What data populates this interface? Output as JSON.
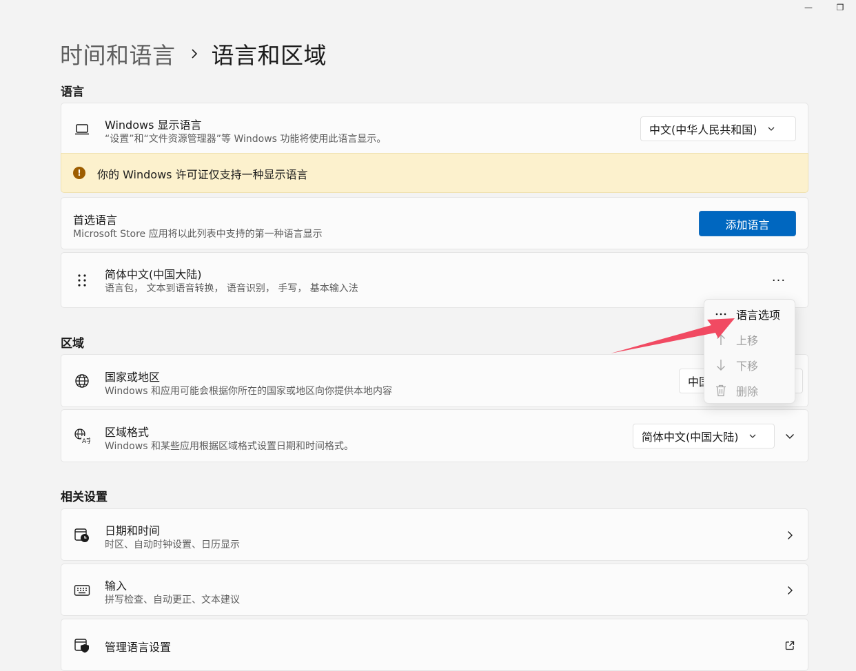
{
  "window": {
    "minimize_glyph": "—",
    "restore_glyph": "❐"
  },
  "breadcrumb": {
    "parent": "时间和语言",
    "separator": "›",
    "current": "语言和区域"
  },
  "sections": {
    "language": "语言",
    "region": "区域",
    "related": "相关设置"
  },
  "display_language": {
    "title": "Windows 显示语言",
    "subtitle": "“设置”和“文件资源管理器”等 Windows 功能将使用此语言显示。",
    "value": "中文(中华人民共和国)"
  },
  "warning": {
    "text": "你的 Windows 许可证仅支持一种显示语言",
    "icon": "!"
  },
  "preferred": {
    "title": "首选语言",
    "subtitle": "Microsoft Store 应用将以此列表中支持的第一种语言显示",
    "add_button": "添加语言"
  },
  "language_item": {
    "title": "简体中文(中国大陆)",
    "subtitle": "语言包， 文本到语音转换， 语音识别， 手写， 基本输入法",
    "more": "···"
  },
  "context_menu": {
    "items": [
      {
        "label": "语言选项",
        "icon": "more-icon",
        "enabled": true
      },
      {
        "label": "上移",
        "icon": "arrow-up-icon",
        "enabled": false
      },
      {
        "label": "下移",
        "icon": "arrow-down-icon",
        "enabled": false
      },
      {
        "label": "删除",
        "icon": "trash-icon",
        "enabled": false
      }
    ]
  },
  "country": {
    "title": "国家或地区",
    "subtitle": "Windows 和应用可能会根据你所在的国家或地区向你提供本地内容",
    "value_partial": "中国"
  },
  "regional_format": {
    "title": "区域格式",
    "subtitle": "Windows 和某些应用根据区域格式设置日期和时间格式。",
    "value": "简体中文(中国大陆)"
  },
  "related": {
    "datetime": {
      "title": "日期和时间",
      "subtitle": "时区、自动时钟设置、日历显示"
    },
    "input": {
      "title": "输入",
      "subtitle": "拼写检查、自动更正、文本建议"
    },
    "admin": {
      "title": "管理语言设置"
    }
  },
  "colors": {
    "accent": "#0067c0",
    "warning_bg": "#fcf1cd",
    "warning_icon": "#9d5d00",
    "annotation_arrow": "#f0405a"
  }
}
